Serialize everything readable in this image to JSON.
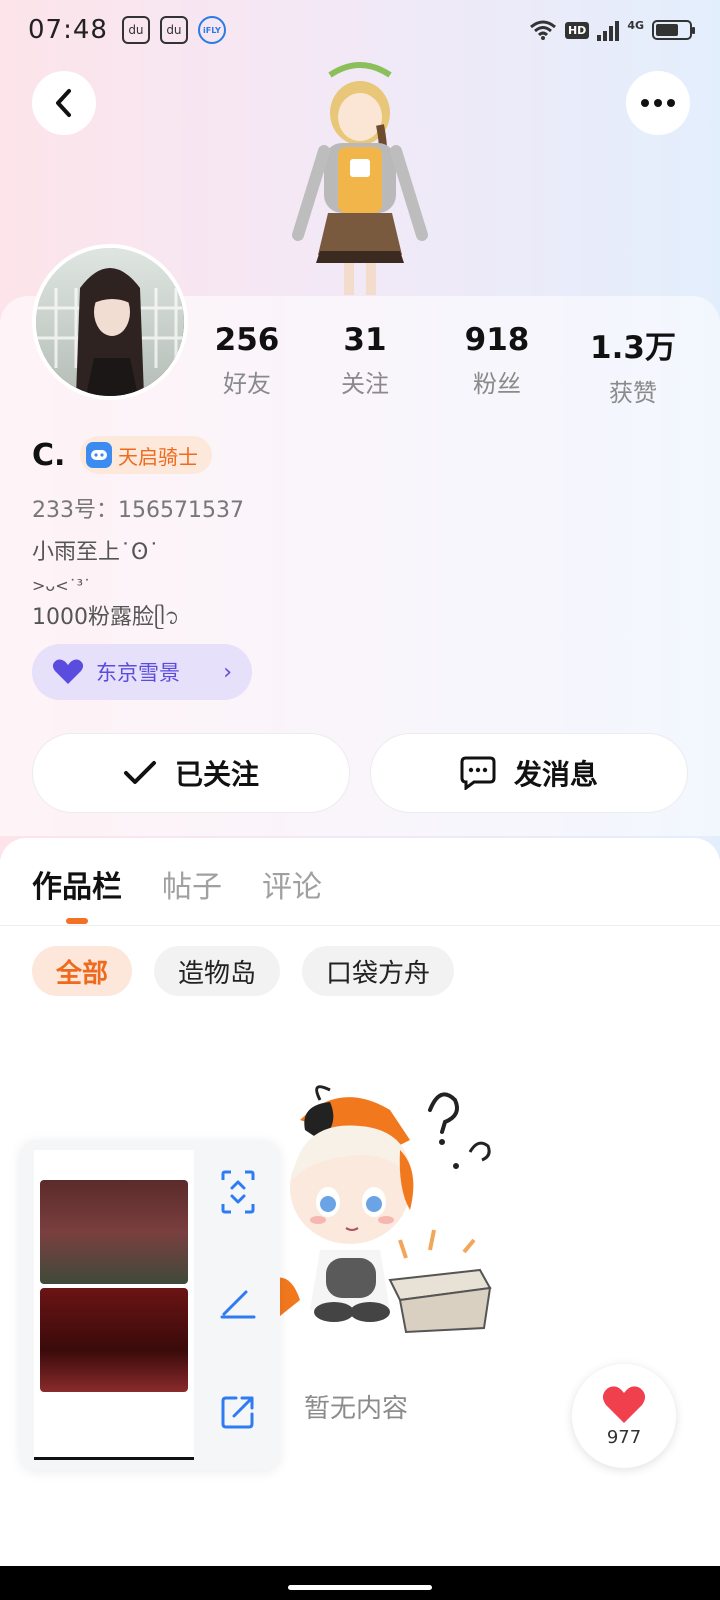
{
  "status_bar": {
    "time": "07:48",
    "apps": [
      "du",
      "du",
      "iFLY"
    ],
    "network": "4G",
    "hd": "HD"
  },
  "profile": {
    "stats": [
      {
        "value": "256",
        "label": "好友"
      },
      {
        "value": "31",
        "label": "关注"
      },
      {
        "value": "918",
        "label": "粉丝"
      },
      {
        "value": "1.3万",
        "label": "获赞"
      }
    ],
    "username": "C.",
    "badge": "天启骑士",
    "uid": "233号：156571537",
    "bio_line1": "小雨至上˙ʘ˙",
    "bio_line2": ">ᴗ<˙³˙",
    "bio_line3": "1000粉露脸ᥫ᭡",
    "tag": "东京雪景"
  },
  "actions": {
    "follow_label": "已关注",
    "message_label": "发消息"
  },
  "tabs": [
    {
      "label": "作品栏",
      "active": true
    },
    {
      "label": "帖子",
      "active": false
    },
    {
      "label": "评论",
      "active": false
    }
  ],
  "filters": [
    {
      "label": "全部",
      "active": true
    },
    {
      "label": "造物岛",
      "active": false
    },
    {
      "label": "口袋方舟",
      "active": false
    }
  ],
  "empty_state": {
    "text": "暂无内容"
  },
  "like": {
    "count": "977"
  },
  "colors": {
    "accent": "#f06a1d",
    "tag": "#5b4ce0",
    "tool_blue": "#2f7bf2",
    "heart": "#f0404e"
  }
}
